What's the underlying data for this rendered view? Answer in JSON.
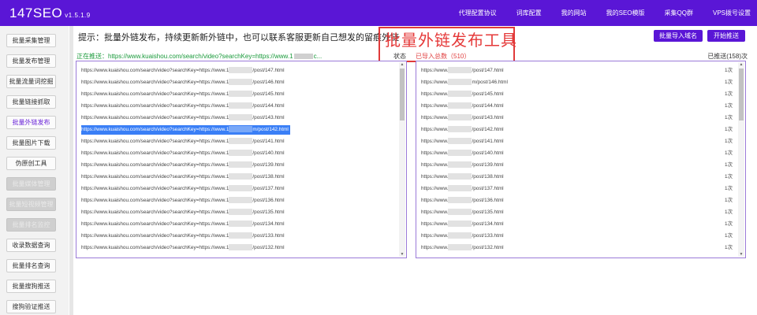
{
  "app": {
    "brand": "147SEO",
    "version": "v1.5.1.9"
  },
  "topnav": [
    "代理配置协议",
    "词库配置",
    "我的网站",
    "我的SEO模版",
    "采集QQ群",
    "VPS拨号设置"
  ],
  "sidebar": [
    {
      "label": "批量采集管理",
      "state": "normal"
    },
    {
      "label": "批量发布管理",
      "state": "normal"
    },
    {
      "label": "批量流量词挖掘",
      "state": "normal"
    },
    {
      "label": "批量链接抓取",
      "state": "normal"
    },
    {
      "label": "批量外链发布",
      "state": "active"
    },
    {
      "label": "批量图片下载",
      "state": "normal"
    },
    {
      "label": "伪原创工具",
      "state": "normal"
    },
    {
      "label": "批量媒体管理",
      "state": "disabled"
    },
    {
      "label": "批量短视频管理",
      "state": "disabled"
    },
    {
      "label": "批量排名监控",
      "state": "disabled"
    },
    {
      "label": "收录数据查询",
      "state": "normal"
    },
    {
      "label": "批量排名查询",
      "state": "normal"
    },
    {
      "label": "批量搜狗推送",
      "state": "normal"
    },
    {
      "label": "搜狗验证推送",
      "state": "normal"
    }
  ],
  "tip": "提示：批量外链发布，持续更新新外链中，也可以联系客服更新自己想发的留痕外链",
  "callout": "批量外链发布工具",
  "buttons": {
    "import": "批量导入域名",
    "start": "开始推送"
  },
  "pushing": {
    "label": "正在推送：",
    "url_prefix": "https://www.kuaishou.com/search/video?searchKey=https://www.1",
    "url_suffix": "c..."
  },
  "status": {
    "label": "状态",
    "value": "已导入总数（510）"
  },
  "pushed": "已推送(158)次",
  "left_list": {
    "prefix": "https://www.kuaishou.com/search/video?searchKey=https://www.1",
    "items": [
      "/post/147.html",
      "/post/146.html",
      "/post/145.html",
      "/post/144.html",
      "/post/143.html",
      "m/post/142.html",
      "/post/141.html",
      "/post/140.html",
      "/post/139.html",
      "/post/138.html",
      "/post/137.html",
      "/post/136.html",
      "/post/135.html",
      "/post/134.html",
      "/post/133.html",
      "/post/132.html"
    ],
    "selected_index": 5
  },
  "right_list": {
    "prefix": "https://www.",
    "items": [
      "/post/147.html",
      "m/post/146.html",
      "/post/145.html",
      "/post/144.html",
      "/post/143.html",
      "/post/142.html",
      "/post/141.html",
      "/post/140.html",
      "/post/139.html",
      "/post/138.html",
      "/post/137.html",
      "/post/136.html",
      "/post/135.html",
      "/post/134.html",
      "/post/133.html",
      "/post/132.html"
    ],
    "counts": [
      "1次",
      "1次",
      "1次",
      "1次",
      "1次",
      "1次",
      "1次",
      "1次",
      "1次",
      "1次",
      "1次",
      "1次",
      "1次",
      "1次",
      "1次",
      "1次"
    ]
  }
}
